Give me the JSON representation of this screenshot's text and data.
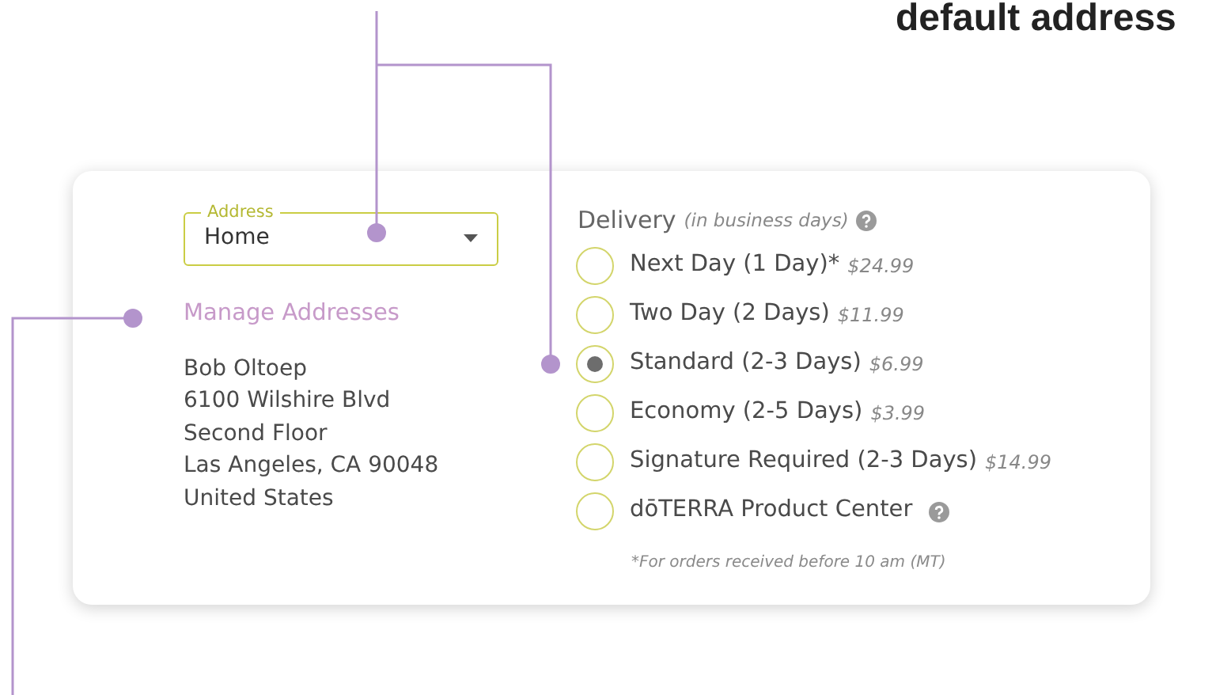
{
  "heading": "default address",
  "address_select": {
    "label": "Address",
    "value": "Home"
  },
  "manage_link": "Manage Addresses",
  "address_lines": [
    "Bob Oltoep",
    "6100 Wilshire Blvd",
    "Second Floor",
    "Las Angeles, CA 90048",
    "United States"
  ],
  "delivery": {
    "title": "Delivery",
    "subtitle": "(in business days)",
    "options": [
      {
        "label": "Next Day (1 Day)*",
        "price": "$24.99",
        "selected": false
      },
      {
        "label": "Two Day (2 Days)",
        "price": "$11.99",
        "selected": false
      },
      {
        "label": "Standard (2-3 Days)",
        "price": "$6.99",
        "selected": true
      },
      {
        "label": "Economy (2-5 Days)",
        "price": "$3.99",
        "selected": false
      },
      {
        "label": "Signature Required (2-3 Days)",
        "price": "$14.99",
        "selected": false
      },
      {
        "label": "dōTERRA Product Center",
        "help": true,
        "selected": false
      }
    ],
    "footnote": "*For orders received before 10 am (MT)"
  }
}
